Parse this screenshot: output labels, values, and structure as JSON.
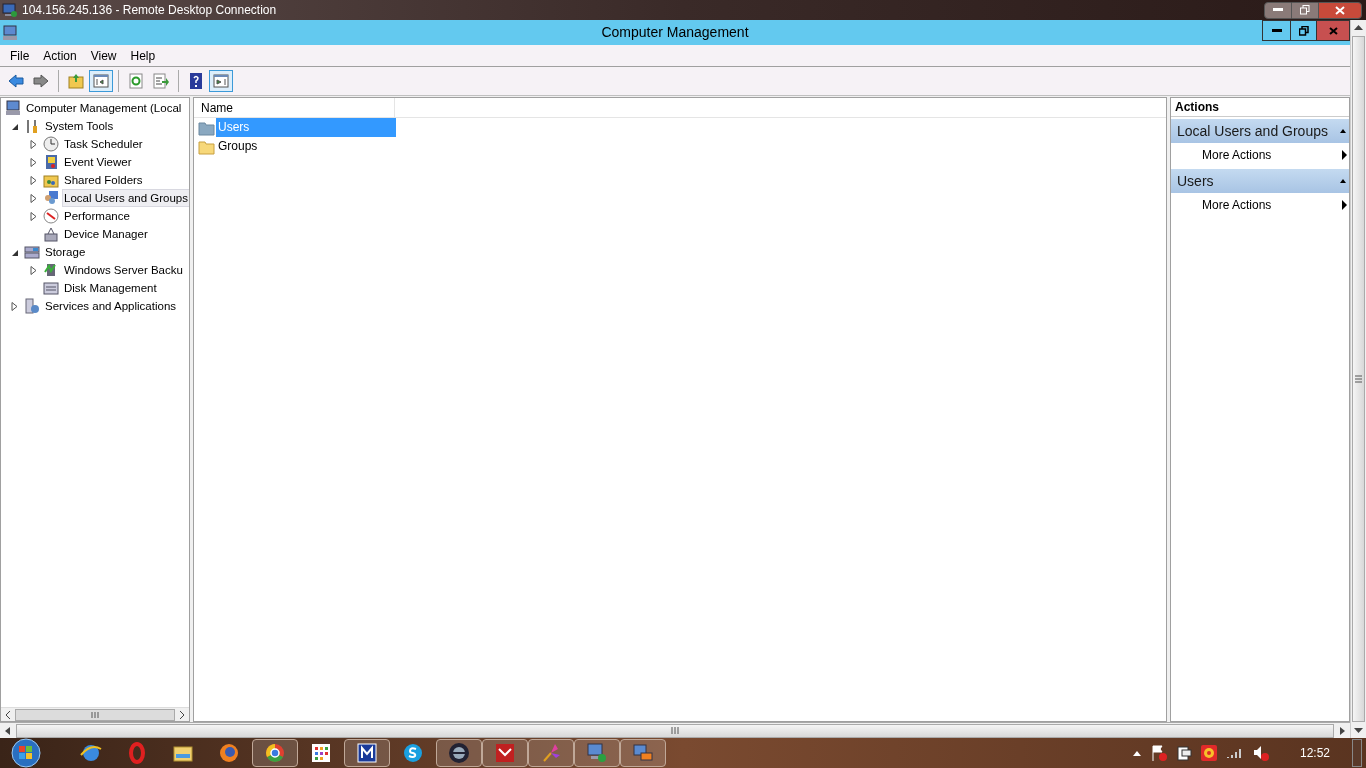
{
  "rdp_window": {
    "title": "104.156.245.136 - Remote Desktop Connection"
  },
  "window": {
    "title": "Computer Management"
  },
  "menu": [
    "File",
    "Action",
    "View",
    "Help"
  ],
  "toolbar": [
    {
      "kind": "back"
    },
    {
      "kind": "forward"
    },
    {
      "kind": "separator"
    },
    {
      "kind": "up"
    },
    {
      "kind": "tree",
      "pressed": true
    },
    {
      "kind": "separator"
    },
    {
      "kind": "refresh"
    },
    {
      "kind": "export"
    },
    {
      "kind": "separator"
    },
    {
      "kind": "help"
    },
    {
      "kind": "actions",
      "pressed": true
    }
  ],
  "tree": [
    {
      "label": "Computer Management (Local",
      "selected": false,
      "children": [
        {
          "label": "System Tools",
          "kind": "branch",
          "expanded": true,
          "selected": false,
          "children": [
            {
              "label": "Task Scheduler",
              "kind": "branch",
              "expanded": false,
              "selected": false
            },
            {
              "label": "Event Viewer",
              "kind": "branch",
              "expanded": false,
              "selected": false
            },
            {
              "label": "Shared Folders",
              "kind": "branch",
              "expanded": false,
              "selected": false
            },
            {
              "label": "Local Users and Groups",
              "kind": "branch",
              "expanded": false,
              "selected": true
            },
            {
              "label": "Performance",
              "kind": "branch",
              "expanded": false,
              "selected": false
            },
            {
              "label": "Device Manager",
              "kind": "leaf",
              "selected": false
            }
          ]
        },
        {
          "label": "Storage",
          "kind": "branch",
          "expanded": true,
          "selected": false,
          "children": [
            {
              "label": "Windows Server Backu",
              "kind": "branch",
              "expanded": false,
              "selected": false
            },
            {
              "label": "Disk Management",
              "kind": "leaf",
              "selected": false
            }
          ]
        },
        {
          "label": "Services and Applications",
          "kind": "branch",
          "expanded": false,
          "selected": false
        }
      ]
    }
  ],
  "list": {
    "columns": [
      "Name"
    ],
    "rows": [
      {
        "name": "Users",
        "selected": true
      },
      {
        "name": "Groups",
        "selected": false
      }
    ]
  },
  "actions": {
    "title": "Actions",
    "sections": [
      {
        "title": "Local Users and Groups",
        "expanded": true,
        "items": [
          "More Actions"
        ]
      },
      {
        "title": "Users",
        "expanded": true,
        "items": [
          "More Actions"
        ]
      }
    ]
  },
  "taskbar": {
    "apps": [
      {
        "kind": "ie",
        "open": false
      },
      {
        "kind": "opera",
        "open": false
      },
      {
        "kind": "explorer",
        "open": false
      },
      {
        "kind": "firefox",
        "open": false
      },
      {
        "kind": "chrome",
        "open": true
      },
      {
        "kind": "grid",
        "open": false
      },
      {
        "kind": "blue",
        "open": true
      },
      {
        "kind": "skype",
        "open": false
      },
      {
        "kind": "round",
        "open": true
      },
      {
        "kind": "red",
        "open": true
      },
      {
        "kind": "pinwheel",
        "open": true
      },
      {
        "kind": "rdp",
        "open": true
      },
      {
        "kind": "remote",
        "open": true
      }
    ],
    "clock": "12:52"
  }
}
